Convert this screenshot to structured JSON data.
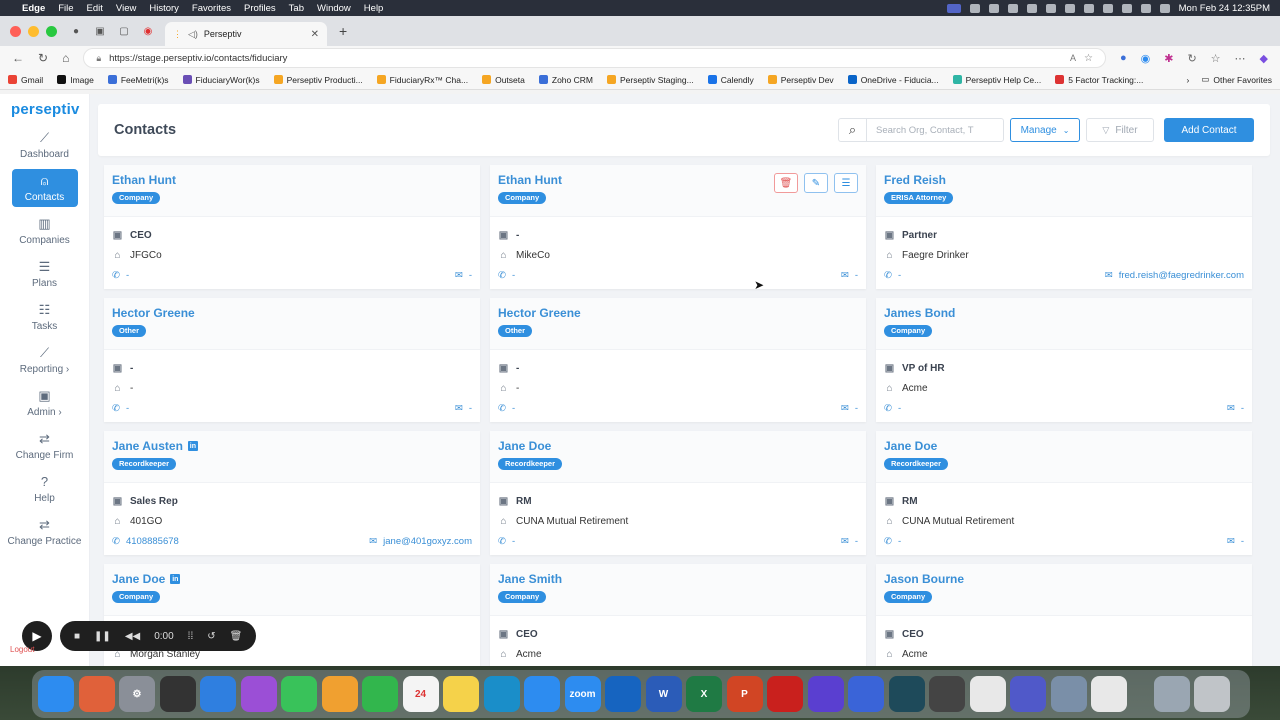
{
  "menubar": {
    "items": [
      "Edge",
      "File",
      "Edit",
      "View",
      "History",
      "Favorites",
      "Profiles",
      "Tab",
      "Window",
      "Help"
    ],
    "clock": "Mon Feb 24  12:35PM"
  },
  "browser": {
    "tab_title": "Perseptiv",
    "url": "https://stage.perseptiv.io/contacts/fiduciary",
    "bookmarks": [
      "Gmail",
      "Image",
      "FeeMetri(k)s",
      "FiduciaryWor(k)s",
      "Perseptiv Producti...",
      "FiduciaryRx™ Cha...",
      "Outseta",
      "Zoho CRM",
      "Perseptiv Staging...",
      "Calendly",
      "Perseptiv Dev",
      "OneDrive - Fiducia...",
      "Perseptiv Help Ce...",
      "5 Factor Tracking:..."
    ],
    "other_favorites": "Other Favorites",
    "bookmark_colors": [
      "#ea4335",
      "#111111",
      "#3b6fd8",
      "#6a4fb5",
      "#f5a623",
      "#f5a623",
      "#f5a623",
      "#3b6fd8",
      "#f5a623",
      "#1a73e8",
      "#f5a623",
      "#0a64c8",
      "#2fb5a5",
      "#d33"
    ]
  },
  "sidebar": {
    "logo": "perseptiv",
    "items": [
      {
        "label": "Dashboard",
        "icon": "chart-icon"
      },
      {
        "label": "Contacts",
        "icon": "person-icon",
        "active": true
      },
      {
        "label": "Companies",
        "icon": "building-icon"
      },
      {
        "label": "Plans",
        "icon": "list-icon"
      },
      {
        "label": "Tasks",
        "icon": "tasks-icon"
      },
      {
        "label": "Reporting ›",
        "icon": "report-icon"
      },
      {
        "label": "Admin ›",
        "icon": "folder-icon"
      },
      {
        "label": "Change Firm",
        "icon": "swap-icon"
      },
      {
        "label": "Help",
        "icon": "help-icon"
      },
      {
        "label": "Change Practice",
        "icon": "swap-icon"
      }
    ],
    "logout": "Logout"
  },
  "header": {
    "title": "Contacts",
    "search_placeholder": "Search Org, Contact, T",
    "manage_label": "Manage",
    "filter_label": "Filter",
    "add_label": "Add Contact"
  },
  "contacts": [
    {
      "name": "Ethan Hunt",
      "tag": "Company",
      "title": "CEO",
      "company": "JFGCo",
      "phone": "-",
      "email": "-",
      "linkedin": false
    },
    {
      "name": "Ethan Hunt",
      "tag": "Company",
      "title": "-",
      "company": "MikeCo",
      "phone": "-",
      "email": "-",
      "linkedin": false,
      "actions": true
    },
    {
      "name": "Fred Reish",
      "tag": "ERISA Attorney",
      "title": "Partner",
      "company": "Faegre Drinker",
      "phone": "-",
      "email": "fred.reish@faegredrinker.com",
      "linkedin": false
    },
    {
      "name": "Hector Greene",
      "tag": "Other",
      "title": "-",
      "company": "-",
      "phone": "-",
      "email": "-",
      "linkedin": false
    },
    {
      "name": "Hector Greene",
      "tag": "Other",
      "title": "-",
      "company": "-",
      "phone": "-",
      "email": "-",
      "linkedin": false
    },
    {
      "name": "James Bond",
      "tag": "Company",
      "title": "VP of HR",
      "company": "Acme",
      "phone": "-",
      "email": "-",
      "linkedin": false
    },
    {
      "name": "Jane Austen",
      "tag": "Recordkeeper",
      "title": "Sales Rep",
      "company": "401GO",
      "phone": "4108885678",
      "email": "jane@401goxyz.com",
      "linkedin": true
    },
    {
      "name": "Jane Doe",
      "tag": "Recordkeeper",
      "title": "RM",
      "company": "CUNA Mutual Retirement",
      "phone": "-",
      "email": "-",
      "linkedin": false
    },
    {
      "name": "Jane Doe",
      "tag": "Recordkeeper",
      "title": "RM",
      "company": "CUNA Mutual Retirement",
      "phone": "-",
      "email": "-",
      "linkedin": false
    },
    {
      "name": "Jane Doe",
      "tag": "Company",
      "title": "",
      "company": "Morgan Stanley",
      "phone": "",
      "email": "",
      "linkedin": true
    },
    {
      "name": "Jane Smith",
      "tag": "Company",
      "title": "CEO",
      "company": "Acme",
      "phone": "",
      "email": "",
      "linkedin": false
    },
    {
      "name": "Jason Bourne",
      "tag": "Company",
      "title": "CEO",
      "company": "Acme",
      "phone": "",
      "email": "",
      "linkedin": false
    }
  ],
  "recorder": {
    "time": "0:00"
  },
  "dock": {
    "icons": [
      {
        "name": "finder",
        "color": "#2d8cf0",
        "glyph": ""
      },
      {
        "name": "launchpad",
        "color": "#e0613a",
        "glyph": ""
      },
      {
        "name": "settings",
        "color": "#8a8f98",
        "glyph": "⚙"
      },
      {
        "name": "activity",
        "color": "#333333",
        "glyph": ""
      },
      {
        "name": "safari",
        "color": "#2f7fe0",
        "glyph": ""
      },
      {
        "name": "podcasts",
        "color": "#9b4fd6",
        "glyph": ""
      },
      {
        "name": "messages",
        "color": "#39c25a",
        "glyph": ""
      },
      {
        "name": "photos",
        "color": "#f0a030",
        "glyph": ""
      },
      {
        "name": "facetime",
        "color": "#32b64d",
        "glyph": ""
      },
      {
        "name": "calendar",
        "color": "#f4f4f4",
        "glyph": "24"
      },
      {
        "name": "notes",
        "color": "#f5d24a",
        "glyph": ""
      },
      {
        "name": "edge",
        "color": "#1a8ec9",
        "glyph": ""
      },
      {
        "name": "appstore",
        "color": "#2d8cf0",
        "glyph": ""
      },
      {
        "name": "zoom",
        "color": "#2d8cf0",
        "glyph": "zoom"
      },
      {
        "name": "outlook",
        "color": "#1664c0",
        "glyph": ""
      },
      {
        "name": "word",
        "color": "#2b5cb8",
        "glyph": "W"
      },
      {
        "name": "excel",
        "color": "#1f7a44",
        "glyph": "X"
      },
      {
        "name": "powerpoint",
        "color": "#d14524",
        "glyph": "P"
      },
      {
        "name": "acrobat",
        "color": "#c9201d",
        "glyph": ""
      },
      {
        "name": "app-purple",
        "color": "#5a3fd0",
        "glyph": ""
      },
      {
        "name": "app-gear",
        "color": "#3a64d8",
        "glyph": ""
      },
      {
        "name": "app-dark",
        "color": "#1e4a5a",
        "glyph": ""
      },
      {
        "name": "calculator",
        "color": "#444444",
        "glyph": ""
      },
      {
        "name": "chrome",
        "color": "#e8e8e8",
        "glyph": ""
      },
      {
        "name": "teams",
        "color": "#5059c9",
        "glyph": ""
      },
      {
        "name": "preview",
        "color": "#7a8fa8",
        "glyph": ""
      },
      {
        "name": "doc",
        "color": "#e8e8e8",
        "glyph": ""
      },
      {
        "name": "folder",
        "color": "#9aa6b2",
        "glyph": ""
      },
      {
        "name": "trash",
        "color": "#c0c4c8",
        "glyph": ""
      }
    ]
  }
}
